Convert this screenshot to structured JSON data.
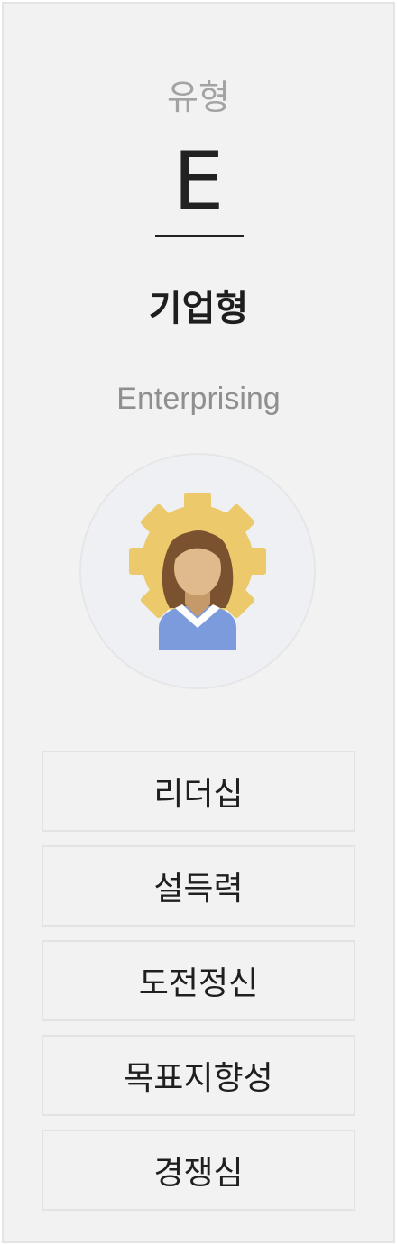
{
  "type": {
    "caption": "유형",
    "letter": "E",
    "title": "기업형",
    "subtitle": "Enterprising"
  },
  "avatar": {
    "icon": "businesswoman-gear-icon",
    "colors": {
      "gear": "#ecc96a",
      "hair": "#7a5230",
      "face": "#e0b98c",
      "neck": "#c69a68",
      "shirt": "#7b9bdc",
      "collar": "#ffffff"
    }
  },
  "traits": [
    {
      "label": "리더십"
    },
    {
      "label": "설득력"
    },
    {
      "label": "도전정신"
    },
    {
      "label": "목표지향성"
    },
    {
      "label": "경쟁심"
    }
  ]
}
